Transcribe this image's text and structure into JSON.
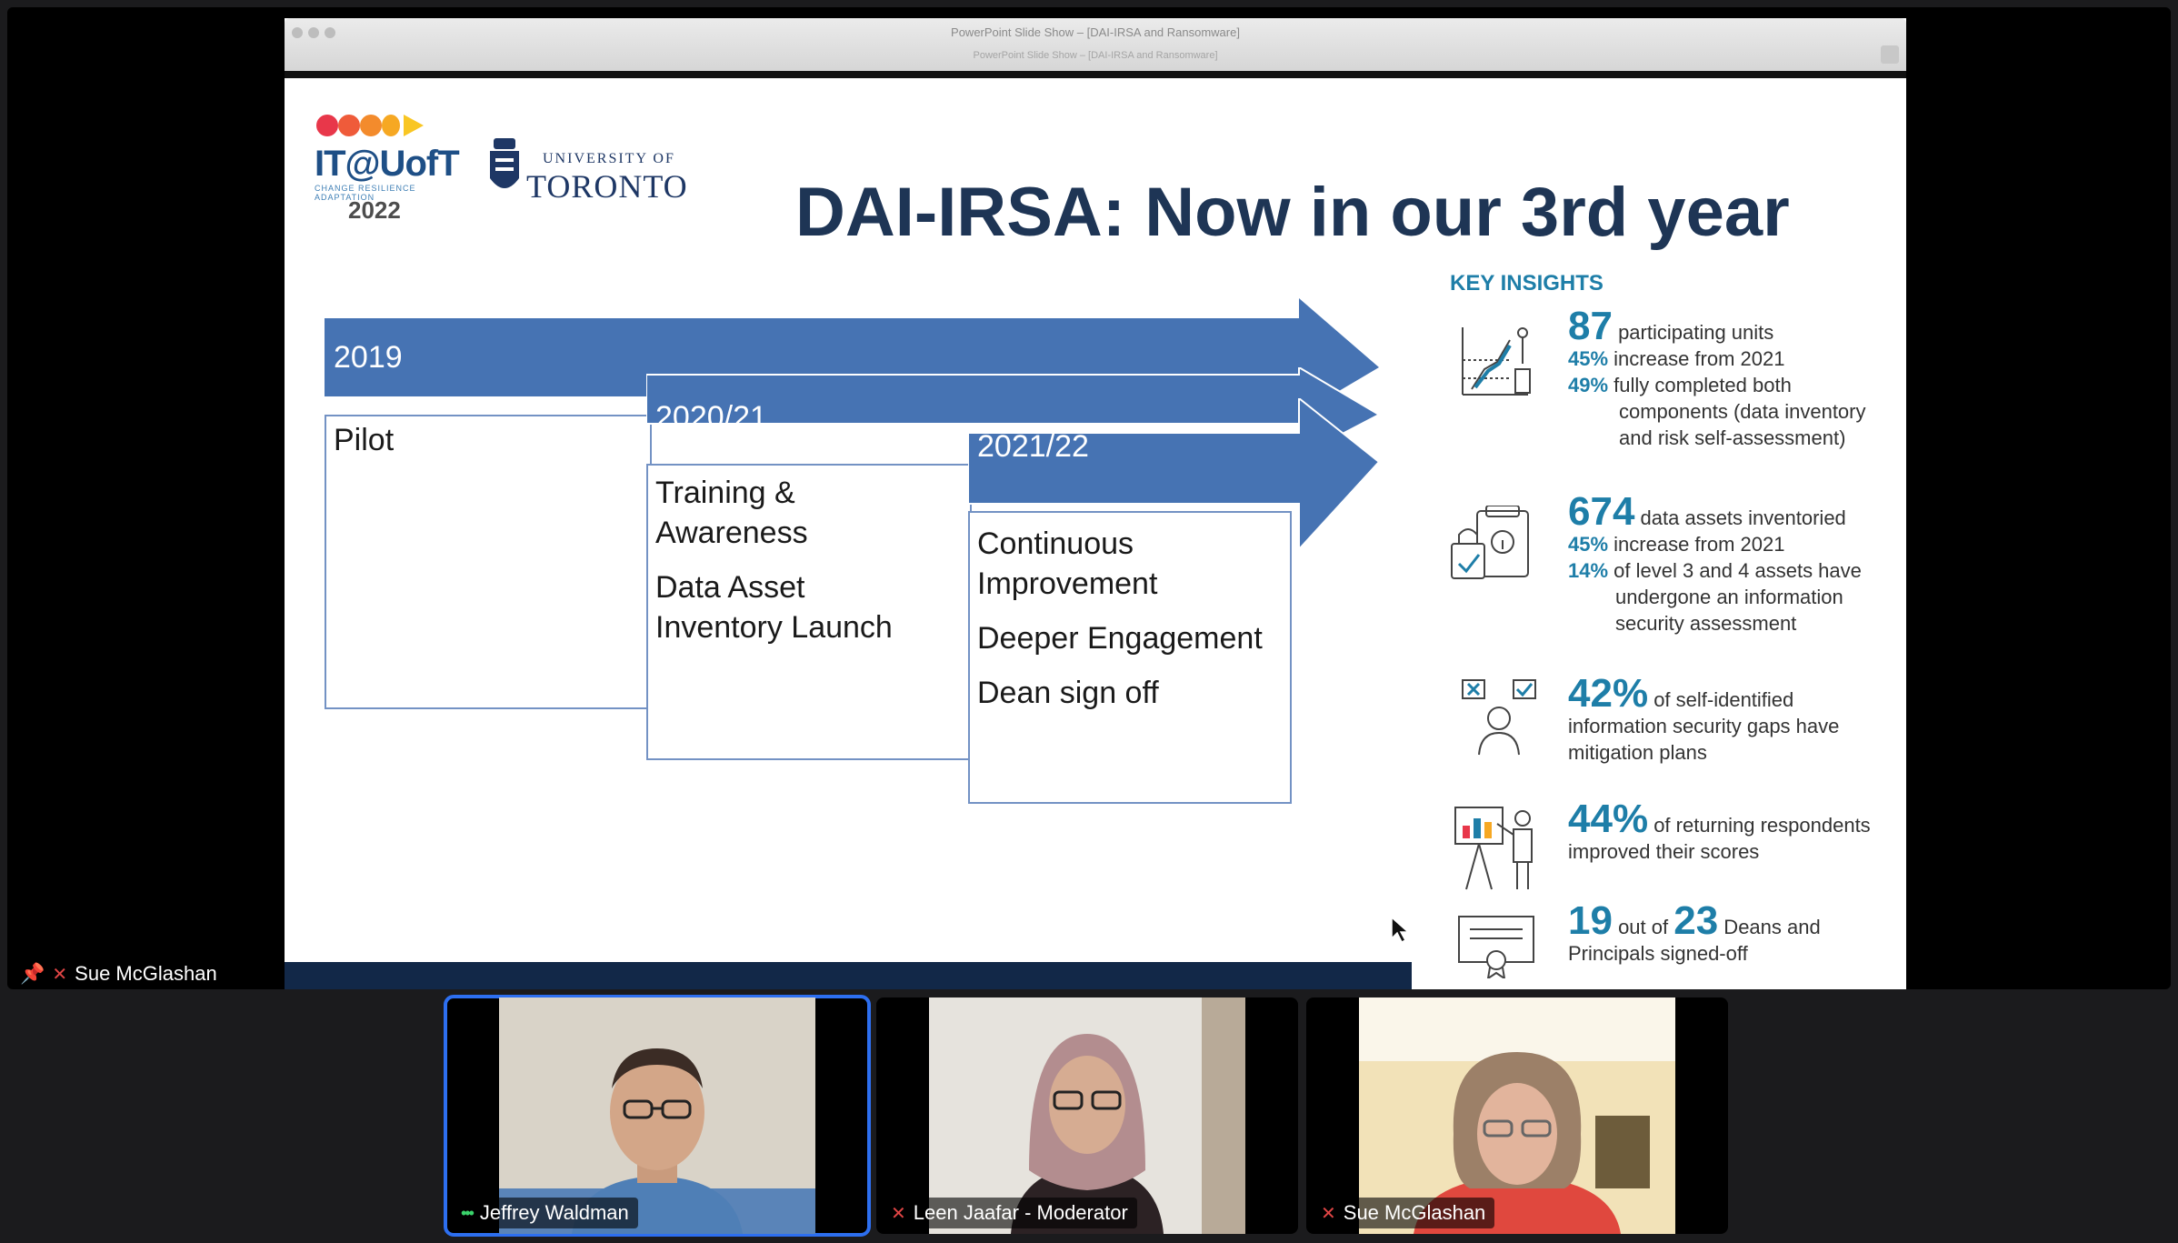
{
  "window": {
    "title": "PowerPoint Slide Show – [DAI-IRSA and Ransomware]",
    "subtitle": "PowerPoint Slide Show – [DAI-IRSA and Ransomware]"
  },
  "slide": {
    "logo": {
      "name": "IT@UofT",
      "tagline": "CHANGE RESILIENCE ADAPTATION",
      "year": "2022",
      "dot_colors": [
        "#e8374a",
        "#ef5b3a",
        "#f38b2c",
        "#f6a823",
        "#f9c623"
      ]
    },
    "university": {
      "line1": "UNIVERSITY OF",
      "line2": "TORONTO"
    },
    "title": "DAI-IRSA: Now in our 3rd year",
    "timeline": [
      {
        "year": "2019",
        "items": [
          "Pilot"
        ]
      },
      {
        "year": "2020/21",
        "items": [
          "Training &\nAwareness",
          "Data Asset\nInventory Launch"
        ]
      },
      {
        "year": "2021/22",
        "items": [
          "Continuous\nImprovement",
          "Deeper Engagement",
          "Dean sign off"
        ]
      }
    ],
    "insights_heading": "KEY INSIGHTS",
    "insights": {
      "units": {
        "big": "87",
        "big_text": " participating units",
        "l1_pct": "45%",
        "l1_text": " increase from 2021",
        "l2_pct": "49%",
        "l2_text": " fully completed both",
        "l2_cont1": "components (data inventory",
        "l2_cont2": "and risk self-assessment)"
      },
      "assets": {
        "big": "674",
        "big_text": " data assets inventoried",
        "l1_pct": "45%",
        "l1_text": " increase from 2021",
        "l2_pct": "14%",
        "l2_text": " of level 3 and 4 assets have",
        "l2_cont1": "undergone an information",
        "l2_cont2": "security assessment"
      },
      "gaps": {
        "big": "42%",
        "big_text": " of self-identified",
        "cont1": "information security gaps have",
        "cont2": "mitigation plans"
      },
      "scores": {
        "big": "44%",
        "big_text": " of returning respondents",
        "cont1": "improved their scores"
      },
      "deans": {
        "big1": "19",
        "mid": " out of ",
        "big2": "23",
        "tail": " Deans and",
        "cont1": "Principals signed-off"
      }
    },
    "colors": {
      "arrow": "#4673b3",
      "title": "#1e3555",
      "accent": "#1e7ea8"
    }
  },
  "stage_label": {
    "name": "Sue McGlashan"
  },
  "participants": [
    {
      "name": "Jeffrey Waldman",
      "status": "speaking"
    },
    {
      "name": "Leen Jaafar - Moderator",
      "status": "muted"
    },
    {
      "name": "Sue McGlashan",
      "status": "muted"
    }
  ]
}
